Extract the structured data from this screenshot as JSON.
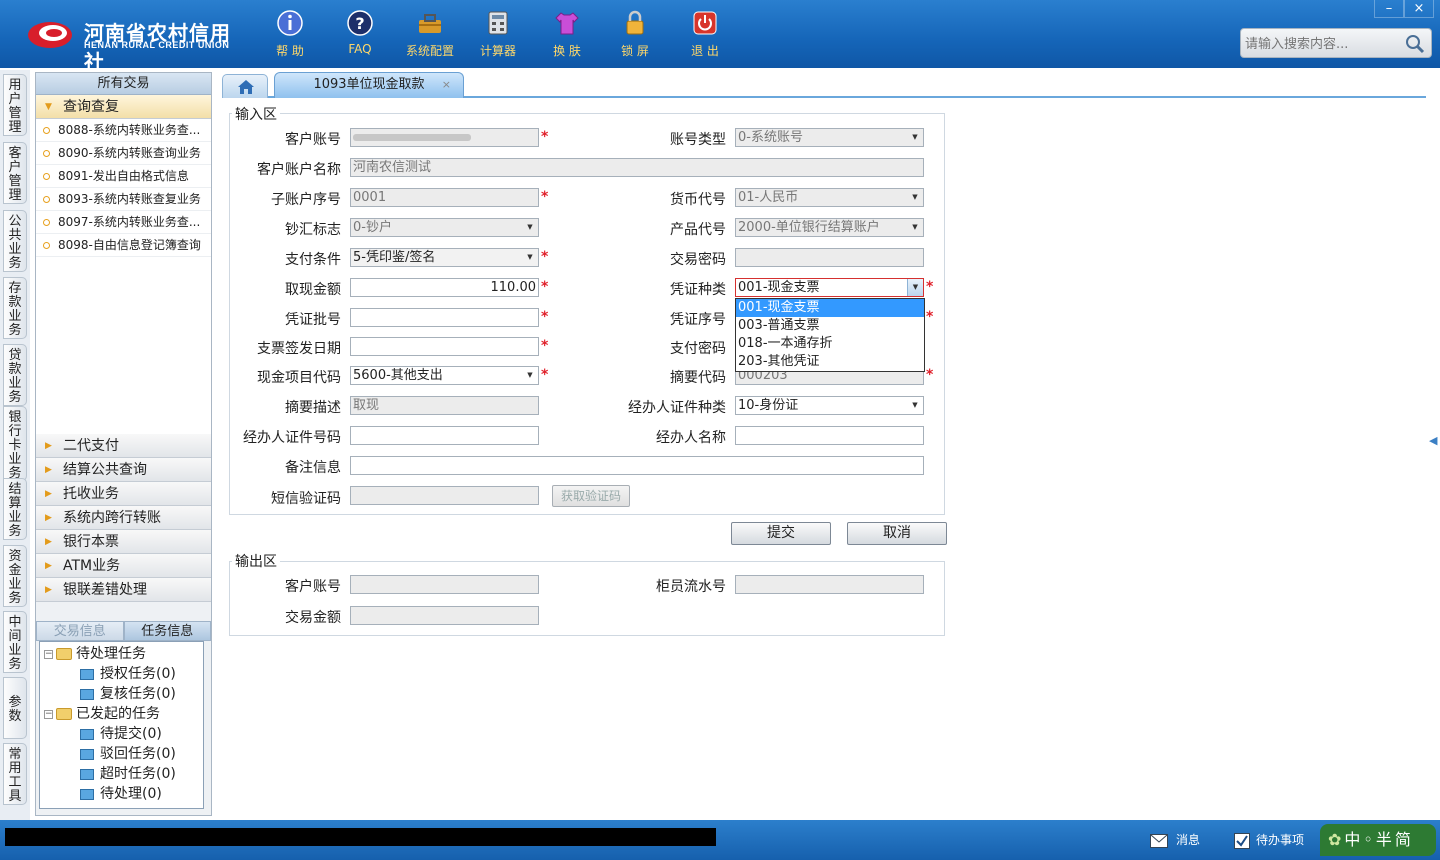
{
  "app": {
    "logo_cn": "河南省农村信用社",
    "logo_en": "HENAN RURAL CREDIT UNION",
    "toolbar": [
      {
        "label": "帮 助",
        "icon": "info-icon"
      },
      {
        "label": "FAQ",
        "icon": "question-icon"
      },
      {
        "label": "系统配置",
        "icon": "toolbox-icon"
      },
      {
        "label": "计算器",
        "icon": "calculator-icon"
      },
      {
        "label": "换 肤",
        "icon": "shirt-icon"
      },
      {
        "label": "锁 屏",
        "icon": "lock-icon"
      },
      {
        "label": "退 出",
        "icon": "power-icon"
      }
    ],
    "window_controls": {
      "minimize": "–",
      "close": "×"
    },
    "search_placeholder": "请输入搜索内容..."
  },
  "side_strip": [
    "用户管理",
    "客户管理",
    "公共业务",
    "存款业务",
    "贷款业务",
    "银行卡业务",
    "结算业务",
    "资金业务",
    "中间业务",
    "参数",
    "常用工具"
  ],
  "left_panel": {
    "header": "所有交易",
    "expanded_group": "查询查复",
    "query_items": [
      "8088-系统内转账业务查...",
      "8090-系统内转账查询业务",
      "8091-发出自由格式信息",
      "8093-系统内转账查复业务",
      "8097-系统内转账业务查...",
      "8098-自由信息登记簿查询"
    ],
    "groups": [
      "二代支付",
      "结算公共查询",
      "托收业务",
      "系统内跨行转账",
      "银行本票",
      "ATM业务",
      "银联差错处理"
    ],
    "task_tabs": [
      "交易信息",
      "任务信息"
    ],
    "tree": {
      "pending": "待处理任务",
      "pending_children": [
        "授权任务(0)",
        "复核任务(0)"
      ],
      "initiated": "已发起的任务",
      "initiated_children": [
        "待提交(0)",
        "驳回任务(0)",
        "超时任务(0)",
        "待处理(0)"
      ]
    }
  },
  "tabs": {
    "current": "1093单位现金取款",
    "close": "×"
  },
  "input_area": {
    "legend": "输入区",
    "labels": {
      "cust_acct": "客户账号",
      "acct_type": "账号类型",
      "cust_name": "客户账户名称",
      "sub_acct": "子账户序号",
      "currency": "货币代号",
      "cash_flag": "钞汇标志",
      "product": "产品代号",
      "pay_cond": "支付条件",
      "trade_pwd": "交易密码",
      "amount": "取现金额",
      "voucher_type": "凭证种类",
      "voucher_batch": "凭证批号",
      "voucher_seq": "凭证序号",
      "cheque_date": "支票签发日期",
      "pay_pwd": "支付密码",
      "cash_item": "现金项目代码",
      "summary_code": "摘要代码",
      "summary_desc": "摘要描述",
      "agent_id_type": "经办人证件种类",
      "agent_id_no": "经办人证件号码",
      "agent_name": "经办人名称",
      "remark": "备注信息",
      "sms_code": "短信验证码"
    },
    "values": {
      "cust_acct": "",
      "acct_type": "0-系统账号",
      "cust_name": "河南农信测试",
      "sub_acct": "0001",
      "currency": "01-人民币",
      "cash_flag": "0-钞户",
      "product": "2000-单位银行结算账户",
      "pay_cond": "5-凭印鉴/签名",
      "trade_pwd": "",
      "amount": "110.00",
      "voucher_type": "001-现金支票",
      "voucher_batch": "",
      "voucher_seq": "",
      "cheque_date": "",
      "pay_pwd": "",
      "cash_item": "5600-其他支出",
      "summary_code": "000203",
      "summary_desc": "取现",
      "agent_id_type": "10-身份证",
      "agent_id_no": "",
      "agent_name": "",
      "remark": "",
      "sms_code": ""
    },
    "voucher_options": [
      "001-现金支票",
      "003-普通支票",
      "018-一本通存折",
      "203-其他凭证"
    ],
    "get_code_button": "获取验证码",
    "required_mark": "*"
  },
  "actions": {
    "submit": "提交",
    "cancel": "取消"
  },
  "output_area": {
    "legend": "输出区",
    "labels": {
      "cust_acct": "客户账号",
      "teller_seq": "柜员流水号",
      "trade_amount": "交易金额"
    },
    "values": {
      "cust_acct": "",
      "teller_seq": "",
      "trade_amount": ""
    }
  },
  "status_bar": {
    "message": "消息",
    "todo": "待办事项",
    "ime": "中◦半简"
  },
  "colors": {
    "topbar": "#1565b8",
    "accent_label": "#ffd86a",
    "required": "#e0202a",
    "highlight": "#3399ff"
  }
}
